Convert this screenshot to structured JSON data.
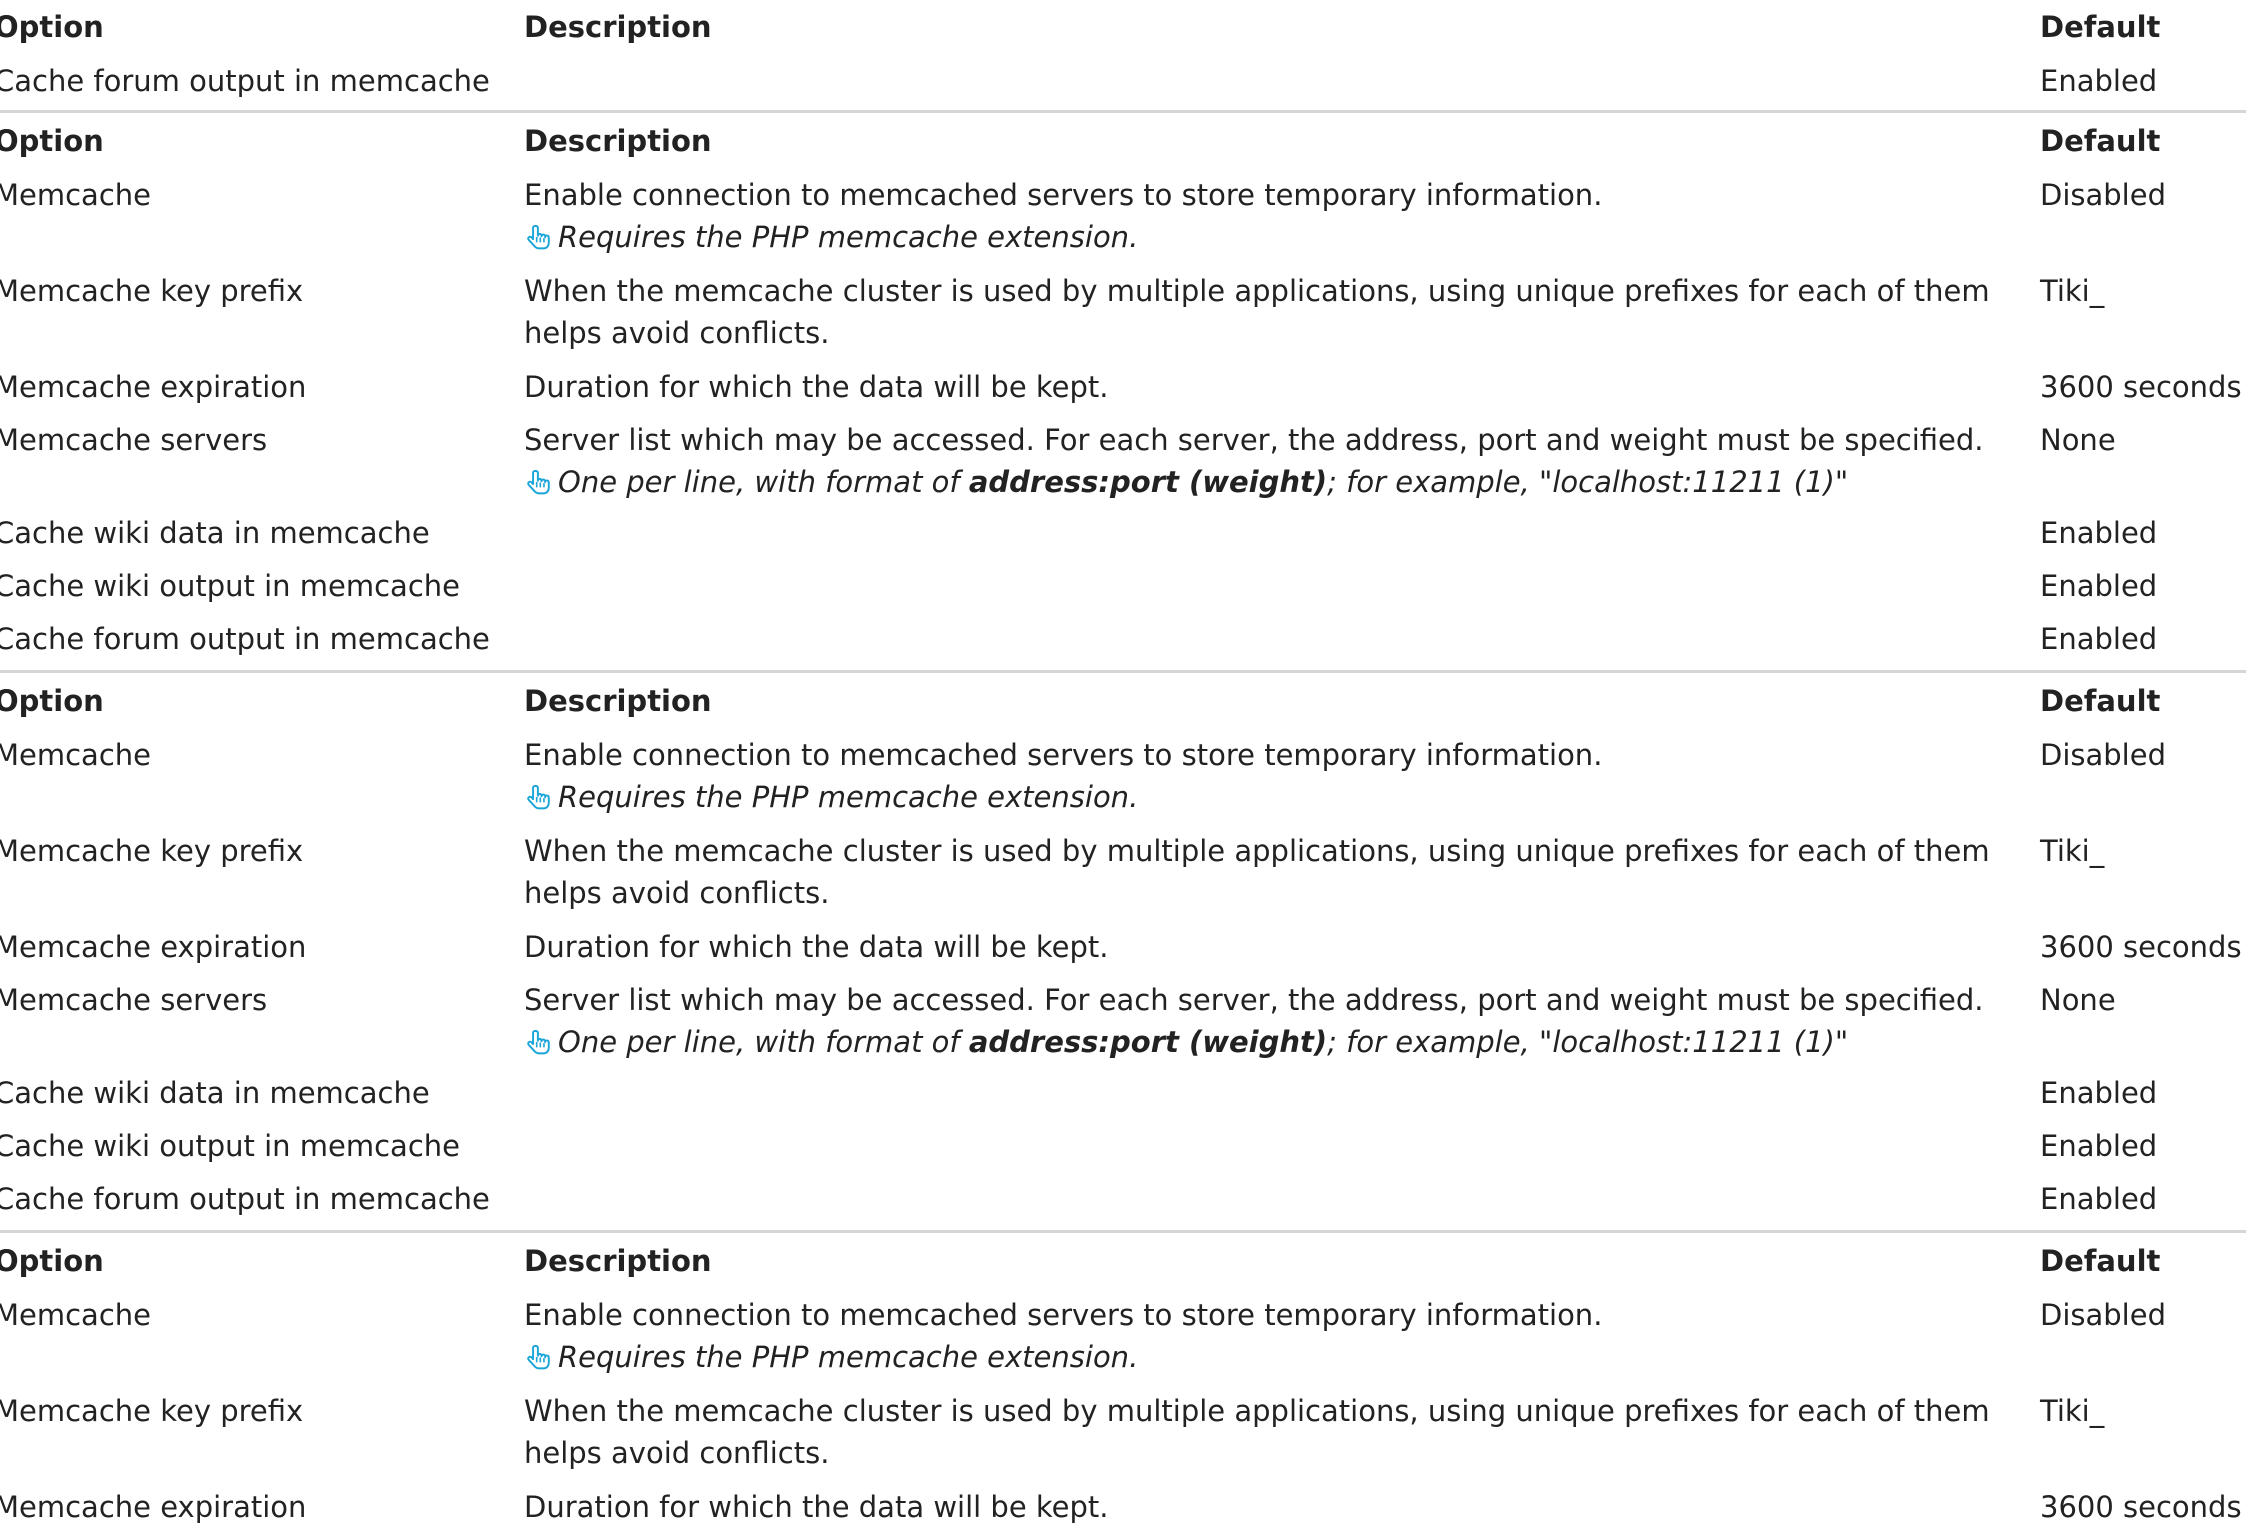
{
  "header": {
    "option": "Option",
    "description": "Description",
    "default": "Default"
  },
  "rows": {
    "memcache": {
      "option": "Memcache",
      "description": "Enable connection to memcached servers to store temporary information.",
      "tip": "Requires the PHP memcache extension.",
      "default": "Disabled"
    },
    "prefix": {
      "option": "Memcache key prefix",
      "description_line1": "When the memcache cluster is used by multiple applications, using unique prefixes for each of them",
      "description_line2": "helps avoid conflicts.",
      "default": "Tiki_"
    },
    "expiration": {
      "option": "Memcache expiration",
      "description": "Duration for which the data will be kept.",
      "default": "3600 seconds"
    },
    "servers": {
      "option": "Memcache servers",
      "description": "Server list which may be accessed. For each server, the address, port and weight must be specified.",
      "tip_pre": "One per line, with format of ",
      "tip_bold": "address:port (weight)",
      "tip_mid": "; for example, ",
      "tip_quote_open": "\"",
      "tip_example": "localhost:11211 (1)",
      "tip_quote_close": "\"",
      "default": "None"
    },
    "wiki_data": {
      "option": "Cache wiki data in memcache",
      "default": "Enabled"
    },
    "wiki_output": {
      "option": "Cache wiki output in memcache",
      "default": "Enabled"
    },
    "forum_output": {
      "option": "Cache forum output in memcache",
      "default": "Enabled"
    }
  },
  "icons": {
    "tip": "pointing-hand-icon",
    "tip_color": "#1aa6d8"
  }
}
